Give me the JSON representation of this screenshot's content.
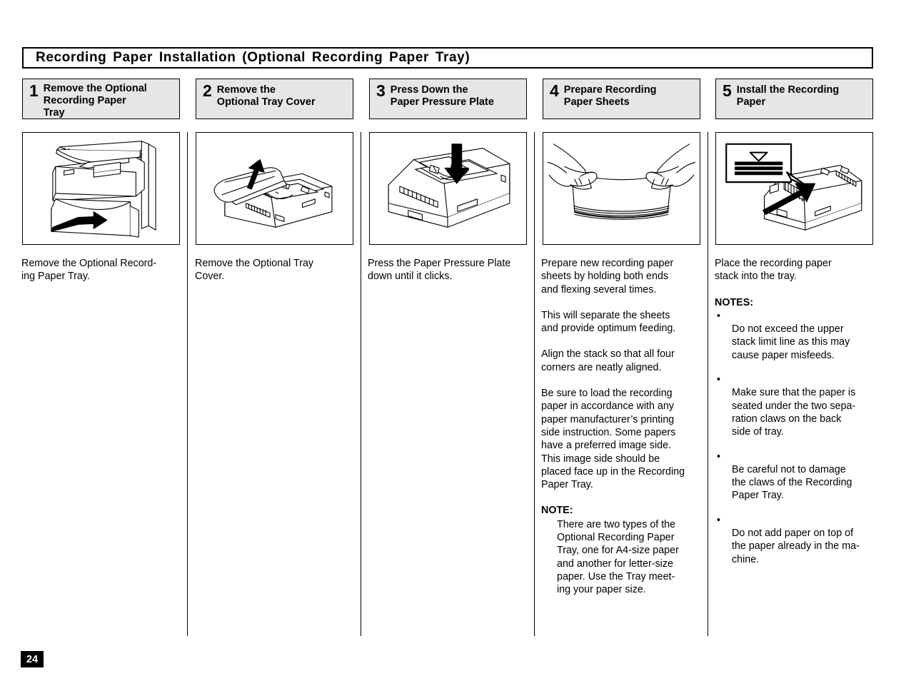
{
  "page": {
    "title": "Recording Paper Installation (Optional Recording Paper Tray)",
    "page_number": "24"
  },
  "steps": [
    {
      "number": "1",
      "label": "Remove the Optional\nRecording Paper\nTray",
      "figure_name": "fax-machine-pull-out-tray-illustration",
      "body": [
        {
          "type": "paragraph",
          "text": "Remove the Optional Record-\ning Paper Tray."
        }
      ]
    },
    {
      "number": "2",
      "label": "Remove the\nOptional Tray Cover",
      "figure_name": "tray-cover-lift-off-illustration",
      "body": [
        {
          "type": "paragraph",
          "text": "Remove the Optional Tray\nCover."
        }
      ]
    },
    {
      "number": "3",
      "label": "Press Down the\nPaper Pressure Plate",
      "figure_name": "press-pressure-plate-illustration",
      "body": [
        {
          "type": "paragraph",
          "text": "Press the Paper Pressure Plate\ndown until it clicks."
        }
      ]
    },
    {
      "number": "4",
      "label": "Prepare Recording\nPaper Sheets",
      "figure_name": "hands-flexing-paper-stack-illustration",
      "body": [
        {
          "type": "paragraph",
          "text": "Prepare new recording paper\nsheets by holding both ends\nand flexing several times."
        },
        {
          "type": "paragraph",
          "text": "This will separate the sheets\nand provide optimum feeding."
        },
        {
          "type": "paragraph",
          "text": "Align the stack so that all four\ncorners are neatly aligned."
        },
        {
          "type": "paragraph",
          "text": "Be sure to load the recording\npaper in accordance with any\npaper manufacturer’s printing\nside instruction. Some papers\nhave a preferred image side.\nThis image side should be\nplaced face up in the Recording\nPaper Tray."
        },
        {
          "type": "note",
          "heading": "NOTE:",
          "text": "There are two types of the\nOptional Recording Paper\nTray, one for A4-size paper\nand another for letter-size\npaper. Use the Tray meet-\ning your paper size."
        }
      ]
    },
    {
      "number": "5",
      "label": "Install the Recording\nPaper",
      "figure_name": "insert-paper-stack-into-tray-illustration",
      "body": [
        {
          "type": "paragraph",
          "text": "Place the recording paper\nstack into the tray."
        },
        {
          "type": "notes",
          "heading": "NOTES:",
          "bullet": "•",
          "items": [
            "Do not exceed the upper\nstack limit line as this may\ncause paper misfeeds.",
            "Make sure that the paper is\nseated under the two sepa-\nration claws on the back\nside of tray.",
            "Be careful not to damage\nthe claws of the Recording\nPaper Tray.",
            "Do not add paper on top of\nthe paper already in the ma-\nchine."
          ]
        }
      ]
    }
  ],
  "colors": {
    "ink": "#000000",
    "paper": "#ffffff",
    "step_box_fill": "#e6e6e6"
  }
}
